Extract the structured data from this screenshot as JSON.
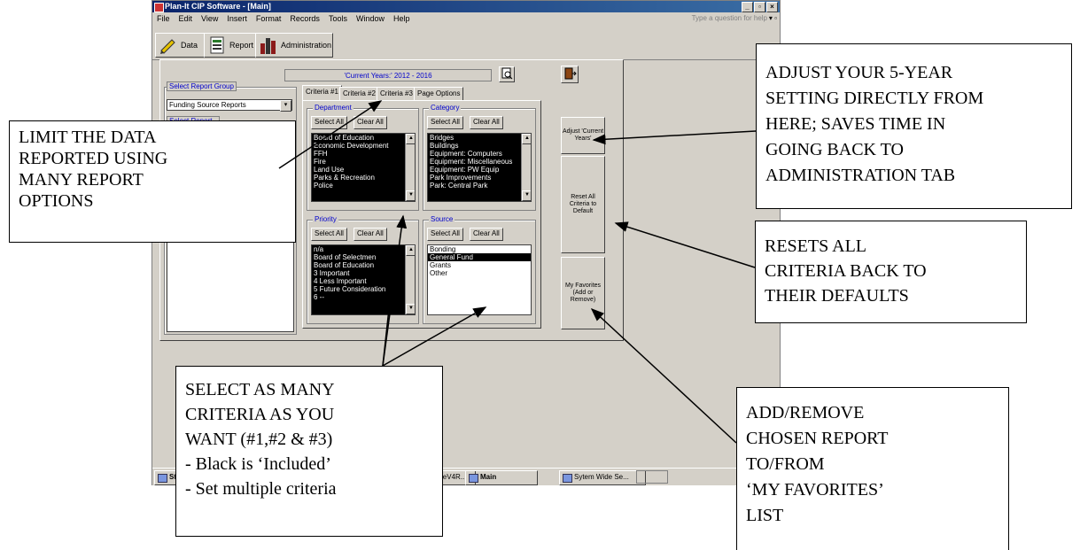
{
  "window": {
    "title": "Plan-It CIP Software - [Main]",
    "controls": [
      "_",
      "×",
      "×"
    ],
    "menu": [
      "File",
      "Edit",
      "View",
      "Insert",
      "Format",
      "Records",
      "Tools",
      "Window",
      "Help"
    ],
    "help_box": "Type a question for help"
  },
  "toolbar": {
    "data_label": "Data",
    "report_label": "Report",
    "admin_label": "Administration"
  },
  "form": {
    "current_years": "'Current Years:' 2012 - 2016",
    "report_group_label": "Select Report Group",
    "report_group_value": "Funding Source Reports",
    "select_report_label": "Select Report",
    "tabs": [
      "Criteria #1",
      "Criteria #2",
      "Criteria #3",
      "Page Options"
    ],
    "select_all": "Select All",
    "clear_all": "Clear All",
    "department": {
      "label": "Department",
      "items": [
        "Board of Education",
        "Economic Development",
        "FFH",
        "Fire",
        "Land Use",
        "Parks & Recreation",
        "Police"
      ]
    },
    "category": {
      "label": "Category",
      "items": [
        "Bridges",
        "Buildings",
        "Equipment: Computers",
        "Equipment: Miscellaneous",
        "Equipment: PW Equip",
        "Park Improvements",
        "Park: Central Park"
      ]
    },
    "priority": {
      "label": "Priority",
      "items": [
        "n/a",
        "Board of Selectmen",
        "Board of Education",
        "3 Important",
        "4 Less Important",
        "5 Future Consideration",
        "6 --"
      ]
    },
    "source": {
      "label": "Source",
      "items": [
        "Bonding",
        "General Fund",
        "Grants",
        "Other"
      ],
      "selected": "General Fund"
    },
    "adjust_button": "Adjust 'Current Years'",
    "reset_button": "Reset All Criteria to Default",
    "favorites_button": "My Favorites (Add or Remove)"
  },
  "taskbar": {
    "start": "St",
    "tasks": [
      "t",
      "UsersGuideV4R...",
      "Main",
      "Sytem Wide Se..."
    ]
  },
  "callouts": {
    "limit": [
      "LIMIT THE DATA",
      "REPORTED USING",
      "MANY REPORT",
      "OPTIONS"
    ],
    "adjust": [
      "ADJUST YOUR 5-YEAR",
      "SETTING DIRECTLY FROM",
      "HERE;  SAVES TIME IN",
      "GOING BACK TO",
      "ADMINISTRATION TAB"
    ],
    "resets": [
      "RESETS ALL",
      "CRITERIA BACK TO",
      "THEIR DEFAULTS"
    ],
    "select": [
      "SELECT AS MANY",
      "CRITERIA AS YOU",
      "WANT (#1,#2 & #3)",
      "- Black is ‘Included’",
      "- Set multiple criteria"
    ],
    "favorites": [
      "ADD/REMOVE",
      "CHOSEN REPORT",
      "TO/FROM",
      "‘MY FAVORITES’",
      "LIST"
    ]
  }
}
